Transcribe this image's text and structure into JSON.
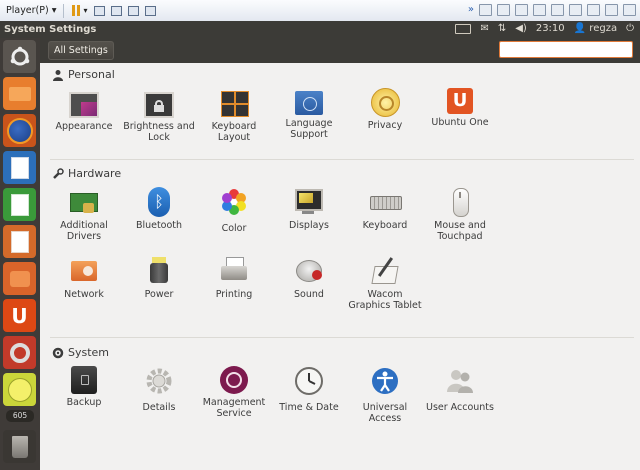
{
  "vm_toolbar": {
    "menu_label": "Player(P)",
    "menu_arrow": "▾"
  },
  "top_panel": {
    "title": "System Settings",
    "time": "23:10",
    "user": "regza"
  },
  "header": {
    "all_settings_label": "All Settings",
    "search_placeholder": "",
    "search_value": ""
  },
  "launcher": {
    "badge": "605"
  },
  "sections": [
    {
      "title": "Personal",
      "items": [
        {
          "label": "Appearance",
          "icon": "appearance-icon"
        },
        {
          "label": "Brightness and Lock",
          "icon": "brightness-icon"
        },
        {
          "label": "Keyboard Layout",
          "icon": "keyboard-layout-icon"
        },
        {
          "label": "Language Support",
          "icon": "language-icon"
        },
        {
          "label": "Privacy",
          "icon": "privacy-icon"
        },
        {
          "label": "Ubuntu One",
          "icon": "ubuntu-one-icon"
        }
      ]
    },
    {
      "title": "Hardware",
      "items": [
        {
          "label": "Additional Drivers",
          "icon": "drivers-icon"
        },
        {
          "label": "Bluetooth",
          "icon": "bluetooth-icon"
        },
        {
          "label": "Color",
          "icon": "color-icon"
        },
        {
          "label": "Displays",
          "icon": "displays-icon"
        },
        {
          "label": "Keyboard",
          "icon": "keyboard-icon"
        },
        {
          "label": "Mouse and Touchpad",
          "icon": "mouse-icon"
        },
        {
          "label": "Network",
          "icon": "network-icon"
        },
        {
          "label": "Power",
          "icon": "power-icon"
        },
        {
          "label": "Printing",
          "icon": "printer-icon"
        },
        {
          "label": "Sound",
          "icon": "sound-icon"
        },
        {
          "label": "Wacom Graphics Tablet",
          "icon": "wacom-icon"
        }
      ]
    },
    {
      "title": "System",
      "items": [
        {
          "label": "Backup",
          "icon": "backup-icon"
        },
        {
          "label": "Details",
          "icon": "details-icon"
        },
        {
          "label": "Management Service",
          "icon": "management-icon"
        },
        {
          "label": "Time & Date",
          "icon": "clock-icon"
        },
        {
          "label": "Universal Access",
          "icon": "accessibility-icon"
        },
        {
          "label": "User Accounts",
          "icon": "users-icon"
        }
      ]
    }
  ]
}
